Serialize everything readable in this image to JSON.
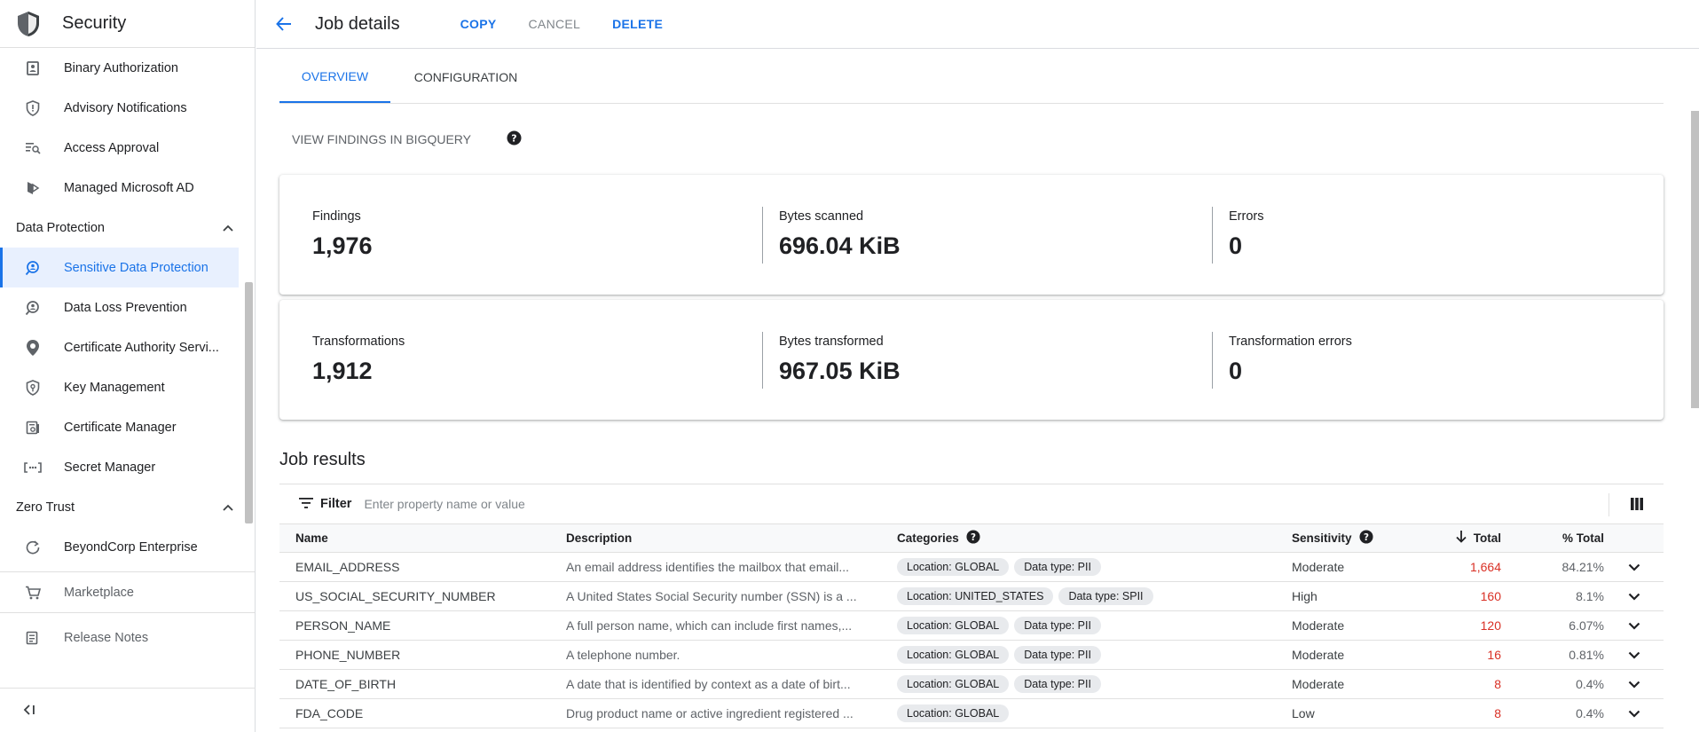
{
  "sidebar": {
    "title": "Security",
    "items": [
      {
        "label": "Binary Authorization",
        "icon": "binary-authorization-icon"
      },
      {
        "label": "Advisory Notifications",
        "icon": "shield-icon"
      },
      {
        "label": "Access Approval",
        "icon": "access-approval-icon"
      },
      {
        "label": "Managed Microsoft AD",
        "icon": "managed-ad-icon"
      }
    ],
    "sections": [
      {
        "label": "Data Protection",
        "items": [
          {
            "label": "Sensitive Data Protection",
            "icon": "sensitive-data-icon",
            "active": true
          },
          {
            "label": "Data Loss Prevention",
            "icon": "data-loss-prevention-icon"
          },
          {
            "label": "Certificate Authority Servi...",
            "icon": "certificate-authority-icon"
          },
          {
            "label": "Key Management",
            "icon": "key-management-icon"
          },
          {
            "label": "Certificate Manager",
            "icon": "certificate-manager-icon"
          },
          {
            "label": "Secret Manager",
            "icon": "secret-manager-icon"
          }
        ]
      },
      {
        "label": "Zero Trust",
        "items": [
          {
            "label": "BeyondCorp Enterprise",
            "icon": "beyondcorp-icon"
          }
        ]
      }
    ],
    "footer_items": [
      {
        "label": "Marketplace",
        "icon": "cart-icon"
      },
      {
        "label": "Release Notes",
        "icon": "release-notes-icon"
      }
    ]
  },
  "topbar": {
    "title": "Job details",
    "copy": "COPY",
    "cancel": "CANCEL",
    "delete": "DELETE"
  },
  "tabs": {
    "overview": "OVERVIEW",
    "configuration": "CONFIGURATION"
  },
  "bigquery_link": "VIEW FINDINGS IN BIGQUERY",
  "stats_row1": [
    {
      "label": "Findings",
      "value": "1,976"
    },
    {
      "label": "Bytes scanned",
      "value": "696.04 KiB"
    },
    {
      "label": "Errors",
      "value": "0"
    }
  ],
  "stats_row2": [
    {
      "label": "Transformations",
      "value": "1,912"
    },
    {
      "label": "Bytes transformed",
      "value": "967.05 KiB"
    },
    {
      "label": "Transformation errors",
      "value": "0"
    }
  ],
  "job_results": {
    "title": "Job results",
    "filter_label": "Filter",
    "filter_placeholder": "Enter property name or value",
    "columns": {
      "name": "Name",
      "description": "Description",
      "categories": "Categories",
      "sensitivity": "Sensitivity",
      "total": "Total",
      "pct_total": "% Total"
    },
    "rows": [
      {
        "name": "EMAIL_ADDRESS",
        "description": "An email address identifies the mailbox that email...",
        "chips": [
          "Location: GLOBAL",
          "Data type: PII"
        ],
        "sensitivity": "Moderate",
        "total": "1,664",
        "pct": "84.21%"
      },
      {
        "name": "US_SOCIAL_SECURITY_NUMBER",
        "description": "A United States Social Security number (SSN) is a ...",
        "chips": [
          "Location: UNITED_STATES",
          "Data type: SPII"
        ],
        "sensitivity": "High",
        "total": "160",
        "pct": "8.1%"
      },
      {
        "name": "PERSON_NAME",
        "description": "A full person name, which can include first names,...",
        "chips": [
          "Location: GLOBAL",
          "Data type: PII"
        ],
        "sensitivity": "Moderate",
        "total": "120",
        "pct": "6.07%"
      },
      {
        "name": "PHONE_NUMBER",
        "description": "A telephone number.",
        "chips": [
          "Location: GLOBAL",
          "Data type: PII"
        ],
        "sensitivity": "Moderate",
        "total": "16",
        "pct": "0.81%"
      },
      {
        "name": "DATE_OF_BIRTH",
        "description": "A date that is identified by context as a date of birt...",
        "chips": [
          "Location: GLOBAL",
          "Data type: PII"
        ],
        "sensitivity": "Moderate",
        "total": "8",
        "pct": "0.4%"
      },
      {
        "name": "FDA_CODE",
        "description": "Drug product name or active ingredient registered ...",
        "chips": [
          "Location: GLOBAL"
        ],
        "sensitivity": "Low",
        "total": "8",
        "pct": "0.4%"
      }
    ]
  },
  "colors": {
    "accent": "#1a73e8",
    "total_red": "#d93025",
    "active_bg": "#e8f0fe"
  }
}
